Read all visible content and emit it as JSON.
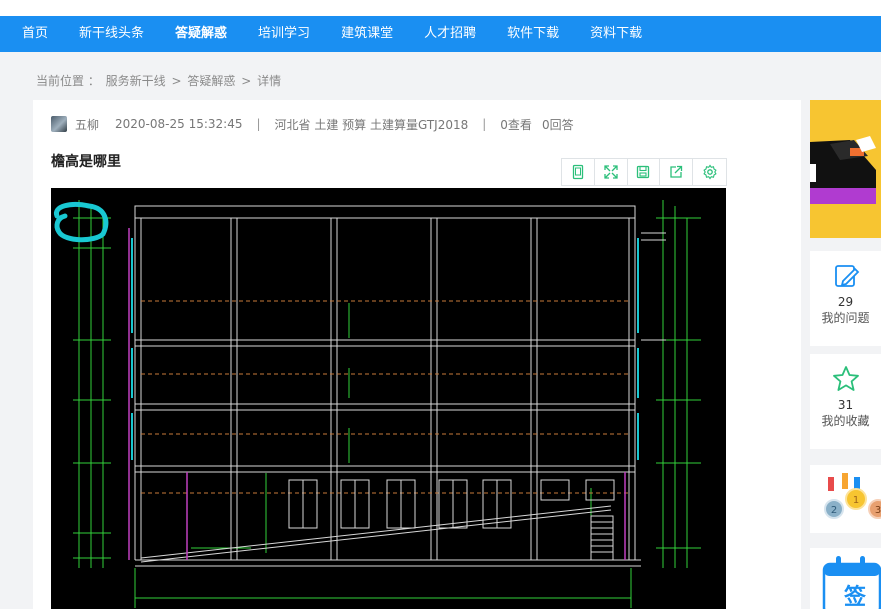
{
  "nav": {
    "items": [
      "首页",
      "新干线头条",
      "答疑解惑",
      "培训学习",
      "建筑课堂",
      "人才招聘",
      "软件下载",
      "资料下载"
    ],
    "active_index": 2
  },
  "breadcrumb": {
    "prefix": "当前位置 ：",
    "items": [
      "服务新干线",
      "答疑解惑",
      "详情"
    ],
    "separator": ">"
  },
  "question": {
    "author": "五柳",
    "datetime": "2020-08-25 15:32:45",
    "tags": "河北省  土建 预算 土建算量GTJ2018",
    "views": "0查看",
    "answers": "0回答",
    "title": "檐高是哪里"
  },
  "toolbar": {
    "icons": [
      "fit-page-icon",
      "fullscreen-icon",
      "save-icon",
      "share-icon",
      "settings-icon"
    ],
    "color": "#2bbf7a"
  },
  "sidebar": {
    "my_questions": {
      "count": "29",
      "label": "我的问题"
    },
    "my_favorites": {
      "count": "31",
      "label": "我的收藏"
    },
    "sign_label": "签"
  },
  "colors": {
    "nav_bg": "#1a8ff2",
    "accent": "#1a8ff2",
    "drawing_bg": "#000000",
    "annotation": "#19c8d2"
  }
}
